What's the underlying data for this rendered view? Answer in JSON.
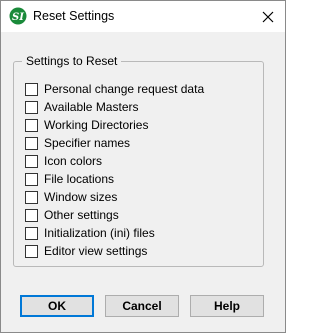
{
  "window": {
    "title": "Reset Settings",
    "icon": "si-app-icon"
  },
  "group": {
    "label": "Settings to Reset",
    "options": [
      {
        "label": "Personal change request data",
        "checked": false
      },
      {
        "label": "Available Masters",
        "checked": false
      },
      {
        "label": "Working Directories",
        "checked": false
      },
      {
        "label": "Specifier names",
        "checked": false
      },
      {
        "label": "Icon colors",
        "checked": false
      },
      {
        "label": "File locations",
        "checked": false
      },
      {
        "label": "Window sizes",
        "checked": false
      },
      {
        "label": "Other settings",
        "checked": false
      },
      {
        "label": "Initialization (ini) files",
        "checked": false
      },
      {
        "label": "Editor view settings",
        "checked": false
      }
    ]
  },
  "buttons": {
    "ok": "OK",
    "cancel": "Cancel",
    "help": "Help"
  },
  "colors": {
    "app_icon": "#1a8a3a",
    "default_button_border": "#0078d7"
  }
}
